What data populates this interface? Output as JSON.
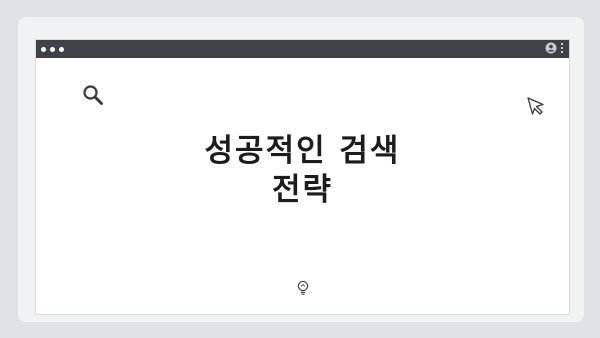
{
  "carousel": {
    "count": 4
  },
  "window": {
    "titlebar_color": "#3f4247",
    "left_icons": [
      "dot-icon",
      "dot-icon",
      "dot-icon"
    ],
    "right_icons": [
      "user-icon",
      "kebab-menu-icon"
    ]
  },
  "content": {
    "title_line1": "성공적인 검색",
    "title_line2": "전략",
    "icons": [
      "search-icon",
      "cursor-icon",
      "lightbulb-icon"
    ]
  }
}
